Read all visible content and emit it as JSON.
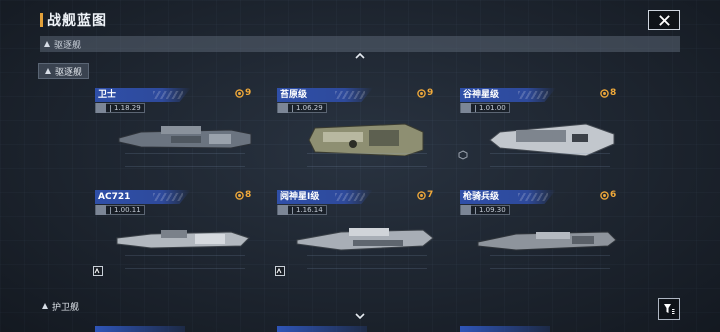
{
  "header": {
    "title": "战舰蓝图",
    "close_icon": "close-icon"
  },
  "section_band": {
    "label": "驱逐舰"
  },
  "categories": {
    "top_chip": "驱逐舰",
    "bottom_chip": "护卫舰"
  },
  "cards": [
    {
      "name": "卫士",
      "tier": "9",
      "stat": "1.18.29",
      "badge": ""
    },
    {
      "name": "苔原级",
      "tier": "9",
      "stat": "1.06.29",
      "badge": ""
    },
    {
      "name": "谷神星级",
      "tier": "8",
      "stat": "1.01.00",
      "badge": "hex"
    },
    {
      "name": "AC721",
      "tier": "8",
      "stat": "1.00.11",
      "badge": "star"
    },
    {
      "name": "阋神星I级",
      "tier": "7",
      "stat": "1.16.14",
      "badge": "star"
    },
    {
      "name": "枪骑兵级",
      "tier": "6",
      "stat": "1.09.30",
      "badge": ""
    }
  ],
  "colors": {
    "accent": "#e3a13a",
    "card_header": "#2f4fa8",
    "tier": "#f0a93a",
    "background": "#1f2630"
  },
  "icons": {
    "tier": "tier-emblem-icon",
    "filter": "filter-icon",
    "caret_up": "chevron-up-icon",
    "caret_down": "chevron-down-icon"
  }
}
